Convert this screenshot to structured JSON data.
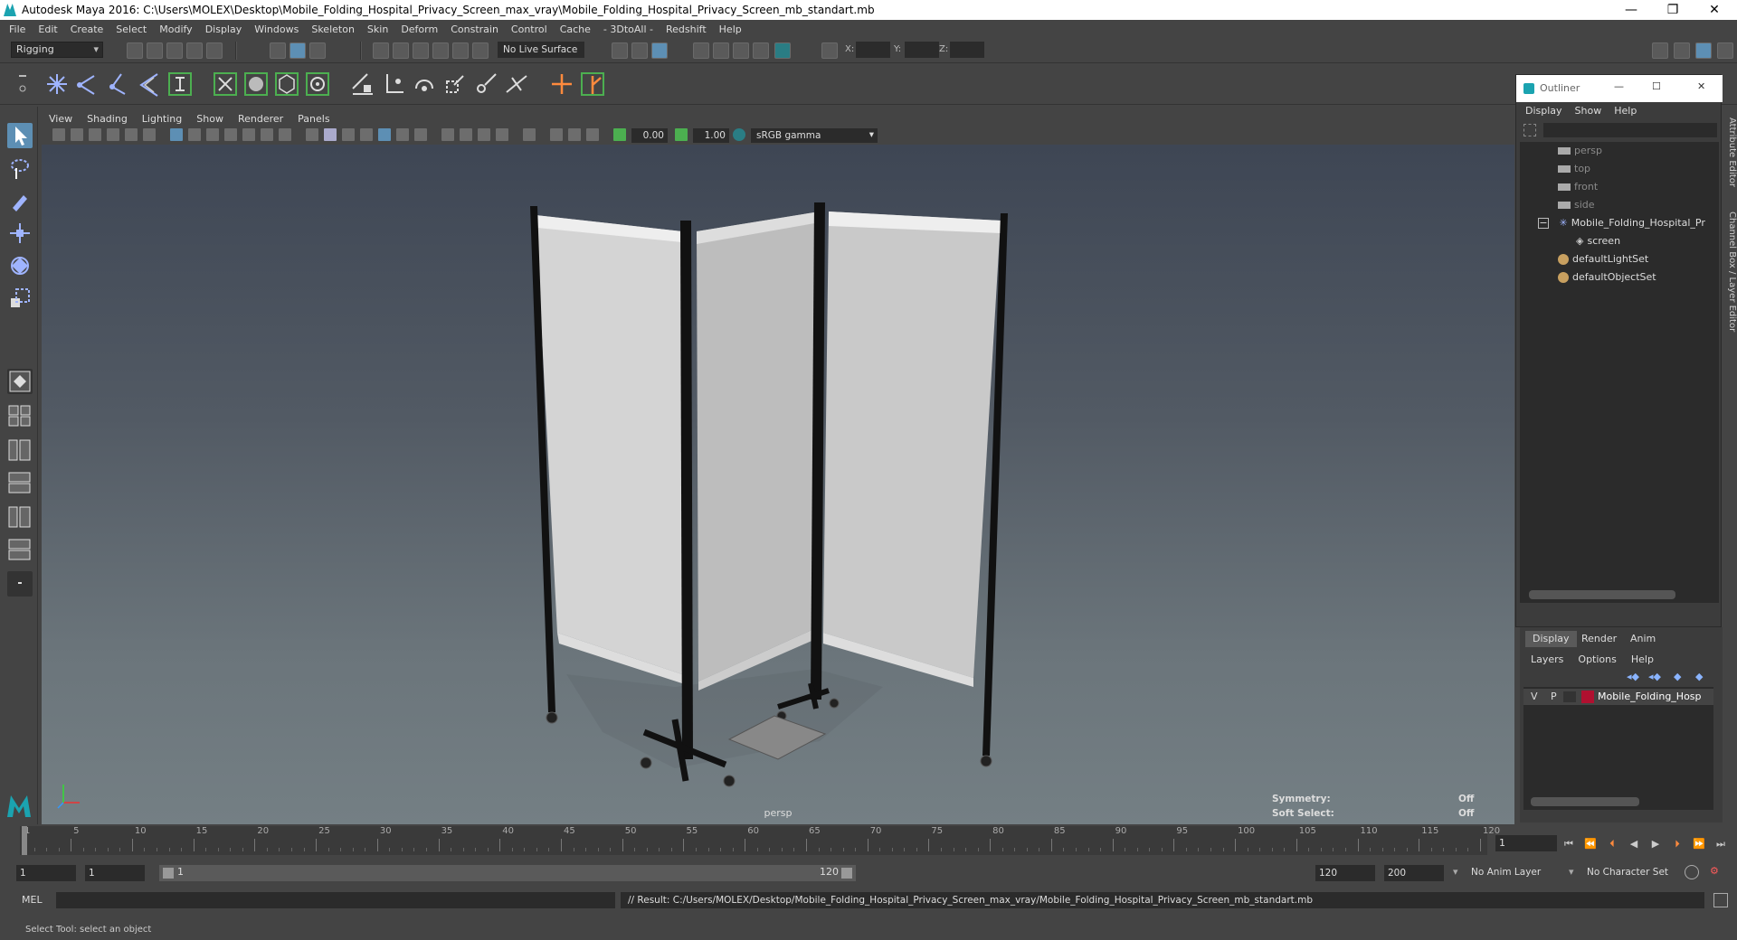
{
  "window": {
    "title": "Autodesk Maya 2016: C:\\Users\\MOLEX\\Desktop\\Mobile_Folding_Hospital_Privacy_Screen_max_vray\\Mobile_Folding_Hospital_Privacy_Screen_mb_standart.mb",
    "minimize": "—",
    "restore": "❐",
    "close": "✕"
  },
  "menubar": [
    "File",
    "Edit",
    "Create",
    "Select",
    "Modify",
    "Display",
    "Windows",
    "Skeleton",
    "Skin",
    "Deform",
    "Constrain",
    "Control",
    "Cache",
    "- 3DtoAll -",
    "Redshift",
    "Help"
  ],
  "statusline": {
    "mode": "Rigging",
    "live_surface": "No Live Surface",
    "x_label": "X:",
    "y_label": "Y:",
    "z_label": "Z:"
  },
  "viewport": {
    "menu": [
      "View",
      "Shading",
      "Lighting",
      "Show",
      "Renderer",
      "Panels"
    ],
    "exposure": "0.00",
    "gamma": "1.00",
    "color_space": "sRGB gamma",
    "camera_label": "persp",
    "symmetry_label": "Symmetry:",
    "symmetry_value": "Off",
    "soft_select_label": "Soft Select:",
    "soft_select_value": "Off"
  },
  "outliner": {
    "title": "Outliner",
    "menu": [
      "Display",
      "Show",
      "Help"
    ],
    "items": [
      {
        "label": "persp",
        "kind": "camera"
      },
      {
        "label": "top",
        "kind": "camera"
      },
      {
        "label": "front",
        "kind": "camera"
      },
      {
        "label": "side",
        "kind": "camera"
      },
      {
        "label": "Mobile_Folding_Hospital_Pr",
        "kind": "group"
      },
      {
        "label": "screen",
        "kind": "mesh"
      },
      {
        "label": "defaultLightSet",
        "kind": "set"
      },
      {
        "label": "defaultObjectSet",
        "kind": "set"
      }
    ]
  },
  "side_tabs": [
    "Attribute Editor",
    "Channel Box / Layer Editor"
  ],
  "layer_editor": {
    "tabs": [
      "Display",
      "Render",
      "Anim"
    ],
    "menu": [
      "Layers",
      "Options",
      "Help"
    ],
    "layer": {
      "v": "V",
      "p": "P",
      "name": "Mobile_Folding_Hosp",
      "color": "#b01030"
    }
  },
  "timeline": {
    "ticks": [
      "1",
      "5",
      "10",
      "15",
      "20",
      "25",
      "30",
      "35",
      "40",
      "45",
      "50",
      "55",
      "60",
      "65",
      "70",
      "75",
      "80",
      "85",
      "90",
      "95",
      "100",
      "105",
      "110",
      "115",
      "120"
    ],
    "current_frame": "1"
  },
  "range": {
    "start": "1",
    "playback_start": "1",
    "slider_start": "1",
    "slider_end": "120",
    "playback_end": "120",
    "end": "200",
    "anim_layer": "No Anim Layer",
    "character_set": "No Character Set"
  },
  "command": {
    "mel_label": "MEL",
    "result": "// Result: C:/Users/MOLEX/Desktop/Mobile_Folding_Hospital_Privacy_Screen_max_vray/Mobile_Folding_Hospital_Privacy_Screen_mb_standart.mb"
  },
  "help_line": "Select Tool: select an object"
}
